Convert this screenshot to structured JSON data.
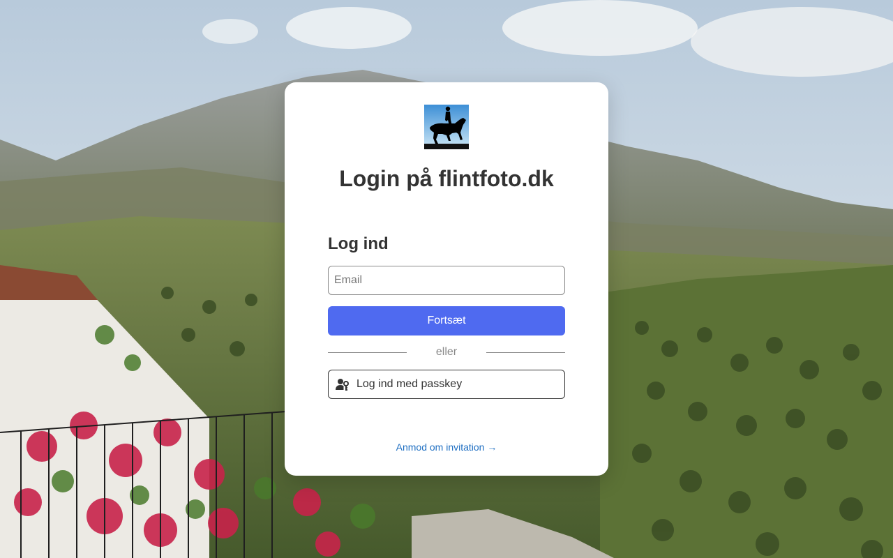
{
  "site": {
    "title": "Login på flintfoto.dk"
  },
  "login": {
    "heading": "Log ind",
    "email_placeholder": "Email",
    "email_value": "",
    "continue_label": "Fortsæt",
    "divider_text": "eller",
    "passkey_label": "Log ind med passkey",
    "passkey_icon": "user-key-icon"
  },
  "footer": {
    "invite_link": "Anmod om invitation →"
  },
  "colors": {
    "primary": "#4f6af0",
    "link": "#1f6fc2",
    "card": "#ffffff",
    "text": "#333333"
  }
}
